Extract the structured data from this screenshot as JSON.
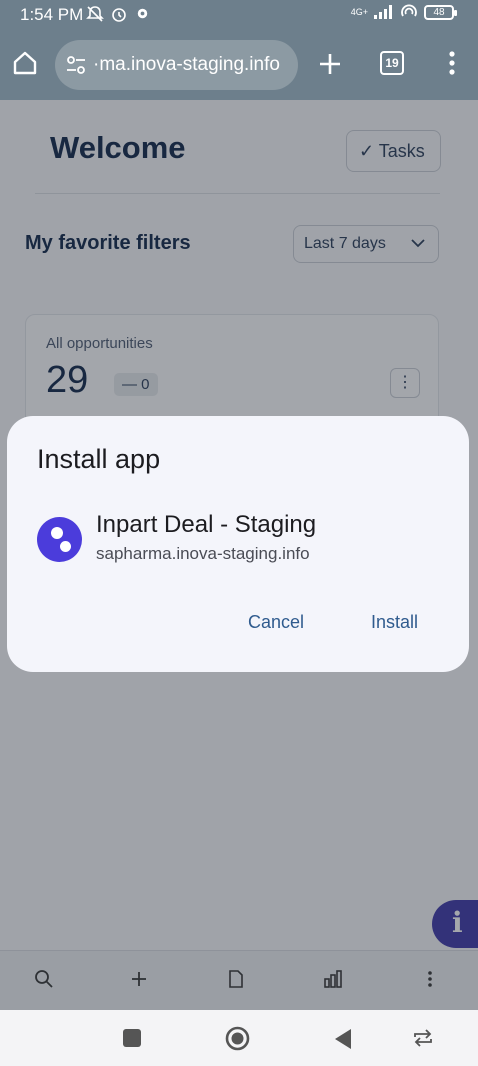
{
  "status_bar": {
    "time": "1:54 PM",
    "network": "4G+",
    "battery": "48",
    "icons": [
      "mute-icon",
      "alarm-icon",
      "settings-icon",
      "signal-icon",
      "hotspot-icon",
      "battery-icon"
    ]
  },
  "browser": {
    "url": "·ma.inova-staging.info",
    "tab_count": "19"
  },
  "page": {
    "welcome": "Welcome",
    "tasks_label": "Tasks",
    "favorites_title": "My favorite filters",
    "range_select": "Last 7 days",
    "card": {
      "label": "All opportunities",
      "count": "29",
      "delta": "— 0"
    },
    "info_label": "i"
  },
  "dialog": {
    "title": "Install app",
    "app_name": "Inpart Deal - Staging",
    "app_url": "sapharma.inova-staging.info",
    "cancel_label": "Cancel",
    "install_label": "Install"
  },
  "colors": {
    "app_icon": "#4b3cdb",
    "dialog_button": "#2f5b8e",
    "brand_text": "#0d2447"
  }
}
